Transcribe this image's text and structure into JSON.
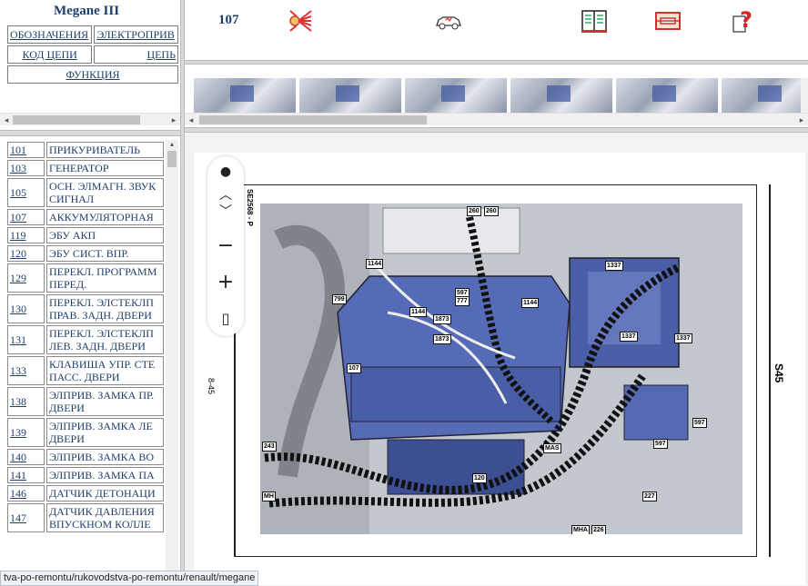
{
  "sidebar": {
    "title": "Megane III",
    "nav": {
      "oboznacheniya": "ОБОЗНАЧЕНИЯ",
      "elektropit": "ЭЛЕКТРОПРИВ",
      "kod_tsepi": "КОД ЦЕПИ",
      "tsep": "ЦЕПЬ",
      "funktsiya": "ФУНКЦИЯ"
    },
    "items": [
      {
        "code": "101",
        "name": "ПРИКУРИВАТЕЛЬ"
      },
      {
        "code": "103",
        "name": "ГЕНЕРАТОР"
      },
      {
        "code": "105",
        "name": "ОСН. ЭЛМАГН. ЗВУК\nСИГНАЛ"
      },
      {
        "code": "107",
        "name": "АККУМУЛЯТОРНАЯ"
      },
      {
        "code": "119",
        "name": "ЭБУ АКП"
      },
      {
        "code": "120",
        "name": "ЭБУ СИСТ. ВПР."
      },
      {
        "code": "129",
        "name": "ПЕРЕКЛ. ПРОГРАММ\nПЕРЕД."
      },
      {
        "code": "130",
        "name": "ПЕРЕКЛ. ЭЛСТЕКЛП\nПРАВ. ЗАДН. ДВЕРИ"
      },
      {
        "code": "131",
        "name": "ПЕРЕКЛ. ЭЛСТЕКЛП\nЛЕВ. ЗАДН. ДВЕРИ"
      },
      {
        "code": "133",
        "name": "КЛАВИША УПР. СТЕ\nПАСС. ДВЕРИ"
      },
      {
        "code": "138",
        "name": "ЭЛПРИВ. ЗАМКА ПР.\nДВЕРИ"
      },
      {
        "code": "139",
        "name": "ЭЛПРИВ. ЗАМКА ЛЕ\nДВЕРИ"
      },
      {
        "code": "140",
        "name": "ЭЛПРИВ. ЗАМКА ВО"
      },
      {
        "code": "141",
        "name": "ЭЛПРИВ. ЗАМКА ПА"
      },
      {
        "code": "146",
        "name": "ДАТЧИК ДЕТОНАЦИ"
      },
      {
        "code": "147",
        "name": "ДАТЧИК ДАВЛЕНИЯ\nВПУСКНОМ КОЛЛЕ"
      }
    ]
  },
  "toolbar": {
    "page_number": "107",
    "icons": [
      "wiring-icon",
      "car-icon",
      "book-icon",
      "fuse-icon",
      "help-icon"
    ]
  },
  "viewer": {
    "side_code": "SE2568 - P",
    "page_ref": "8-45",
    "section": "S45",
    "labels": {
      "l1144a": "1144",
      "l799": "799",
      "l1144b": "1144",
      "l1873a": "1873",
      "l1873b": "1873",
      "l107": "107",
      "l260a": "260",
      "l260b": "260",
      "l597a": "597",
      "l777": "777",
      "l1144c": "1144",
      "l1337a": "1337",
      "l1337b": "1337",
      "l1337c": "1337",
      "l597b": "597",
      "l597c": "597",
      "l243": "243",
      "lmas": "MAS",
      "l120": "120",
      "lmh": "MH",
      "lmha": "MHA",
      "l226": "226",
      "l227": "227"
    }
  },
  "status_bar": "tva-po-remontu/rukovodstva-po-remontu/renault/megane"
}
